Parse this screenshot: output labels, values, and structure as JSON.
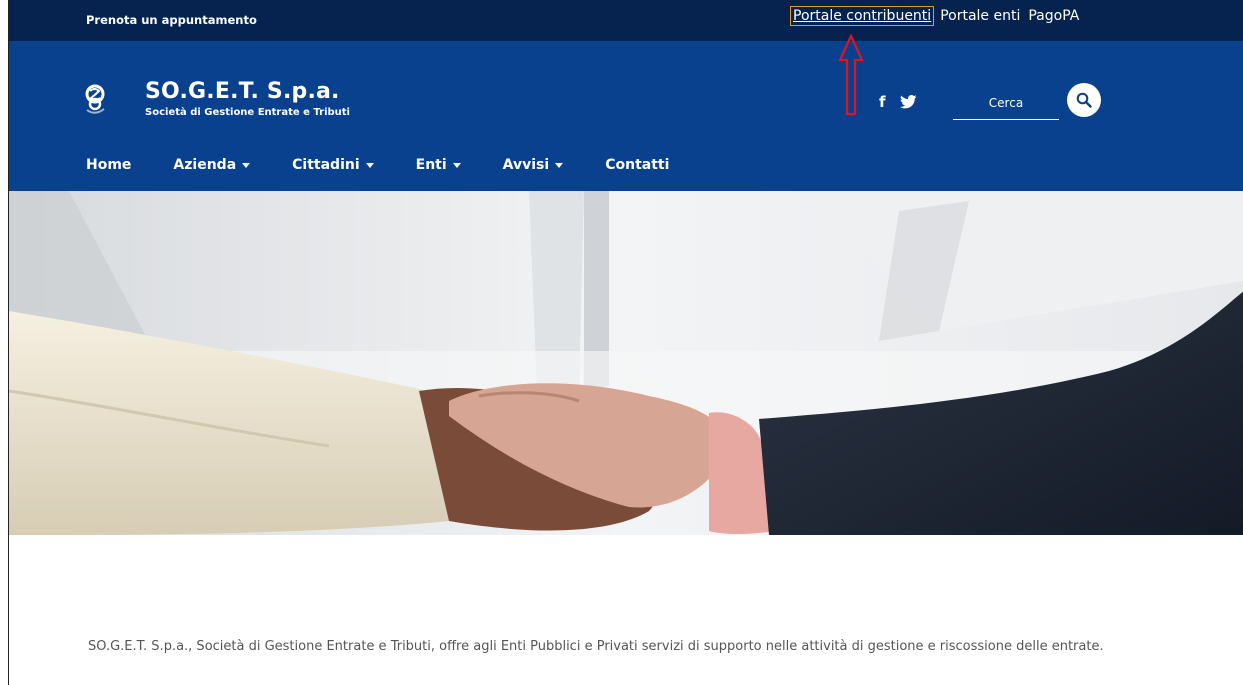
{
  "topbar": {
    "appointment_link": "Prenota un appuntamento",
    "links": [
      "Portale contribuenti",
      "Portale enti",
      "PagoPA"
    ]
  },
  "brand": {
    "name": "SO.G.E.T. S.p.a.",
    "subtitle": "Società di Gestione Entrate e Tributi"
  },
  "social": {
    "facebook": "f"
  },
  "search": {
    "placeholder": "Cerca"
  },
  "nav": {
    "items": [
      {
        "label": "Home",
        "dropdown": false
      },
      {
        "label": "Azienda",
        "dropdown": true
      },
      {
        "label": "Cittadini",
        "dropdown": true
      },
      {
        "label": "Enti",
        "dropdown": true
      },
      {
        "label": "Avvisi",
        "dropdown": true
      },
      {
        "label": "Contatti",
        "dropdown": false
      }
    ]
  },
  "intro": {
    "text": "SO.G.E.T. S.p.a., Società di Gestione Entrate e Tributi, offre agli Enti Pubblici e Privati servizi di supporto nelle attività di gestione e riscossione delle entrate."
  },
  "colors": {
    "topbar": "#06234f",
    "header": "#0a418f",
    "annotation": "#e0141e"
  }
}
